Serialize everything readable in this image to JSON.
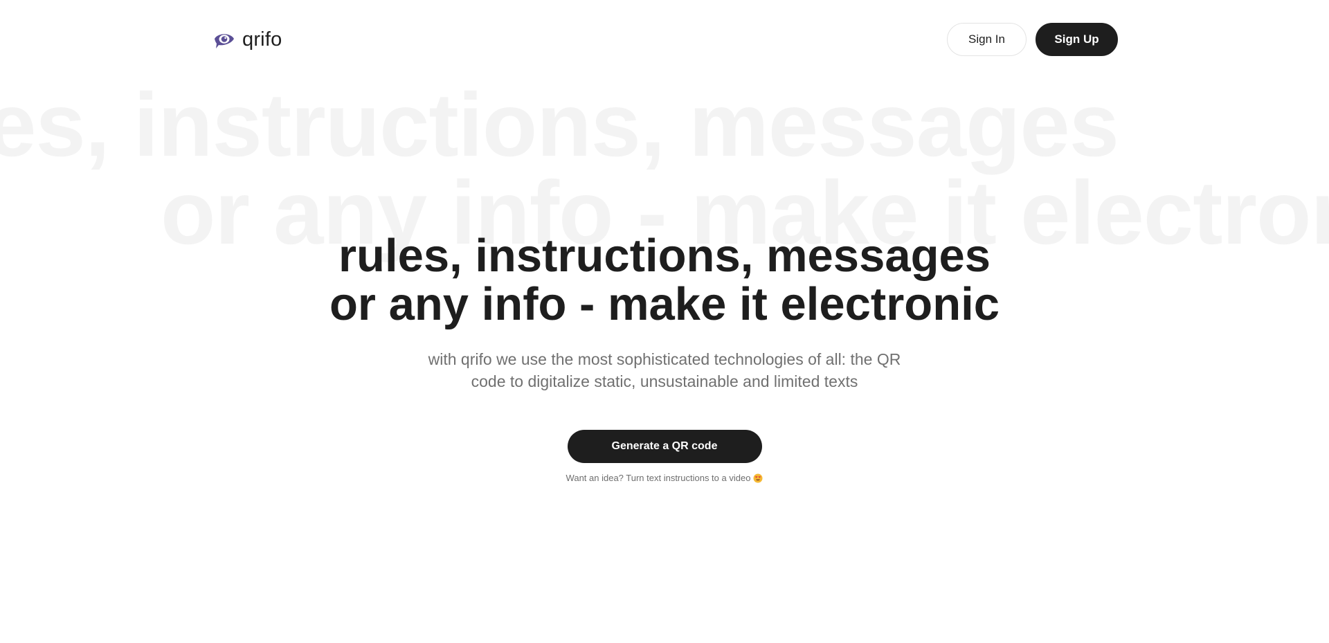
{
  "header": {
    "brand_name": "qrifo",
    "sign_in_label": "Sign In",
    "sign_up_label": "Sign Up"
  },
  "background": {
    "line1": "rules, instructions, messages",
    "line2": "or any info - make it electronic"
  },
  "hero": {
    "title_line1": "rules, instructions, messages",
    "title_line2": "or any info - make it electronic",
    "subtitle_line1": "with qrifo we use the most sophisticated technologies of all: the QR",
    "subtitle_line2": "code to digitalize static, unsustainable and limited texts",
    "cta_label": "Generate a QR code",
    "hint_text": "Want an idea? Turn text instructions to a video",
    "hint_icon": "heart-eyes-emoji-icon"
  },
  "colors": {
    "brand_accent": "#5b4f96",
    "primary_dark": "#1e1e1e",
    "background_text": "#f3f3f3",
    "muted_text": "#707070"
  }
}
